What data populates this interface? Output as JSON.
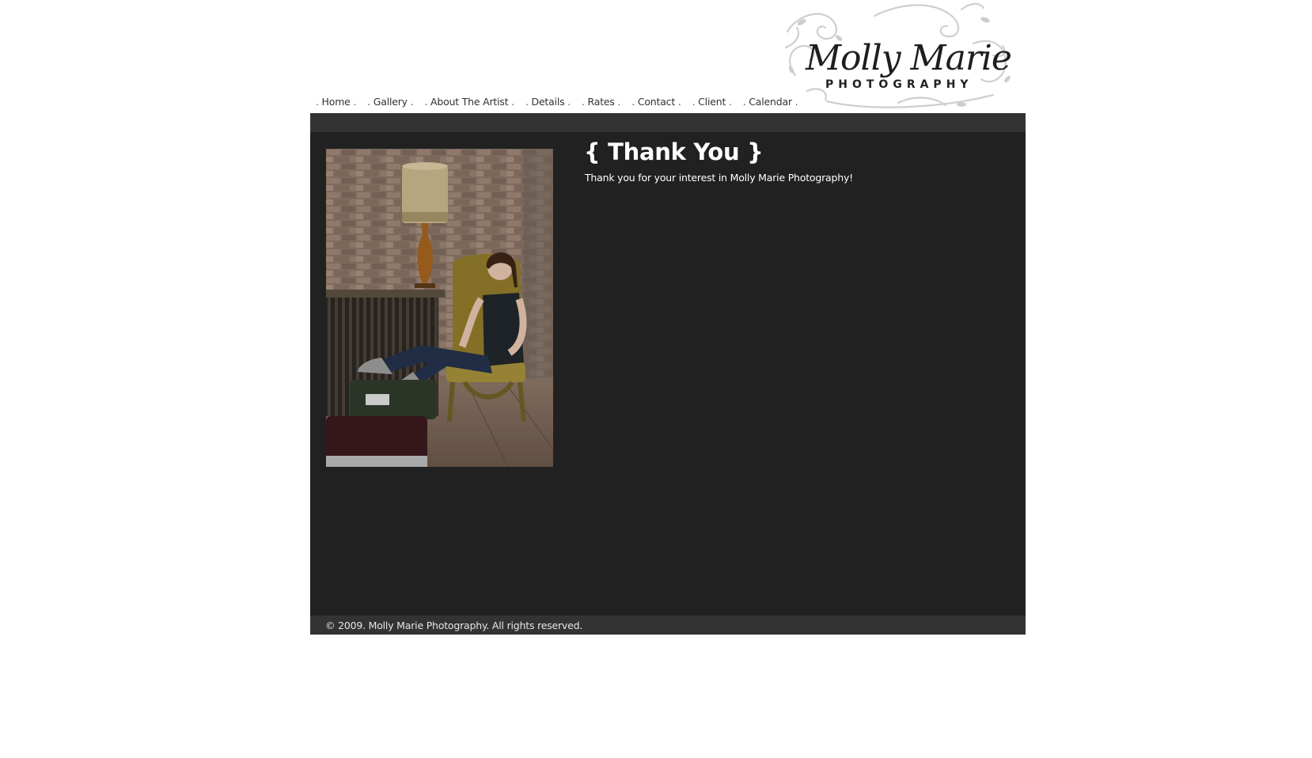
{
  "nav": {
    "items": [
      {
        "label": "Home"
      },
      {
        "label": "Gallery"
      },
      {
        "label": "About The Artist"
      },
      {
        "label": "Details"
      },
      {
        "label": "Rates"
      },
      {
        "label": "Contact"
      },
      {
        "label": "Client"
      },
      {
        "label": "Calendar"
      }
    ]
  },
  "logo": {
    "script_text": "Molly Marie",
    "subtitle": "PHOTOGRAPHY"
  },
  "main": {
    "heading": "{ Thank You }",
    "message": "Thank you for your interest in Molly Marie Photography!"
  },
  "footer": {
    "copyright": "© 2009. Molly Marie Photography. All rights reserved."
  },
  "colors": {
    "panel_bg": "#212121",
    "bar_bg": "#333333",
    "text": "#ffffff",
    "nav_text": "#333333"
  }
}
